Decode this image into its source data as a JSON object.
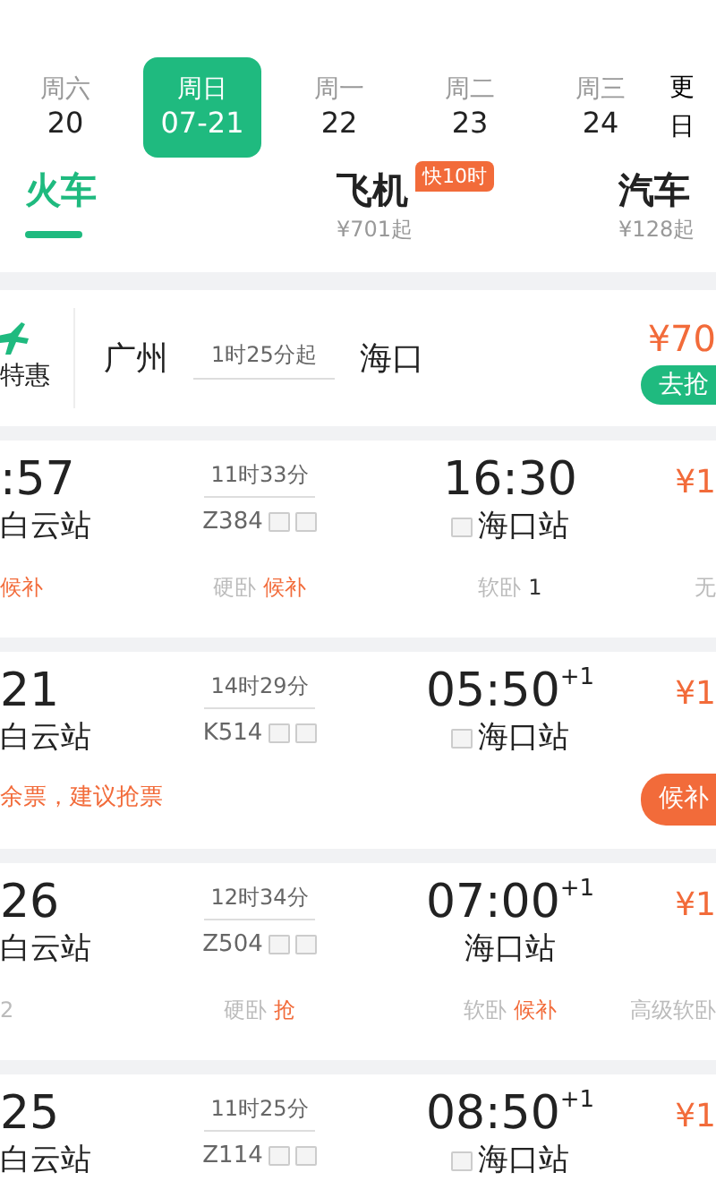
{
  "dates": [
    {
      "weekday": "周六",
      "date": "20",
      "selected": false
    },
    {
      "weekday": "周日",
      "date": "07-21",
      "selected": true
    },
    {
      "weekday": "周一",
      "date": "22",
      "selected": false
    },
    {
      "weekday": "周二",
      "date": "23",
      "selected": false
    },
    {
      "weekday": "周三",
      "date": "24",
      "selected": false
    }
  ],
  "more_dates": {
    "line_1": "更",
    "line_2": "日"
  },
  "modes": [
    {
      "label": "火车",
      "selected": true
    },
    {
      "label": "飞机",
      "price": "¥701起",
      "badge": "快10时",
      "selected": false
    },
    {
      "label": "汽车",
      "price": "¥128起",
      "selected": false
    }
  ],
  "promo": {
    "tag": "特惠",
    "from": "广州",
    "duration": "1时25分起",
    "to": "海口",
    "price": "¥70",
    "button": "去抢"
  },
  "trains": [
    {
      "depart": ":57",
      "depart_station": "白云站",
      "duration": "11时33分",
      "number": "Z384",
      "arrive": "16:30",
      "arrive_icon": true,
      "arrive_station": "海口站",
      "price": "¥1",
      "seats": [
        {
          "status": "候补",
          "kind": "orange"
        },
        {
          "label": "硬卧",
          "status": "候补",
          "kind": "orange"
        },
        {
          "label": "软卧",
          "status": "1",
          "kind": "dark"
        },
        {
          "status": "无",
          "kind": "muted"
        }
      ]
    },
    {
      "depart": "21",
      "depart_station": "白云站",
      "duration": "14时29分",
      "number": "K514",
      "arrive": "05:50",
      "next_day": "+1",
      "arrive_icon": true,
      "arrive_station": "海口站",
      "price": "¥1",
      "notice": "余票，建议抢票",
      "button": "候补"
    },
    {
      "depart": "26",
      "depart_station": "白云站",
      "duration": "12时34分",
      "number": "Z504",
      "arrive": "07:00",
      "next_day": "+1",
      "arrive_icon": false,
      "arrive_station": "海口站",
      "price": "¥1",
      "seats": [
        {
          "status": "2",
          "kind": "muted"
        },
        {
          "label": "硬卧",
          "status": "抢",
          "kind": "orange"
        },
        {
          "label": "软卧",
          "status": "候补",
          "kind": "orange"
        },
        {
          "label": "高级软卧",
          "kind": "muted"
        }
      ]
    },
    {
      "depart": "25",
      "depart_station": "白云站",
      "duration": "11时25分",
      "number": "Z114",
      "arrive": "08:50",
      "next_day": "+1",
      "arrive_icon": true,
      "arrive_station": "海口站",
      "price": "¥1"
    }
  ]
}
